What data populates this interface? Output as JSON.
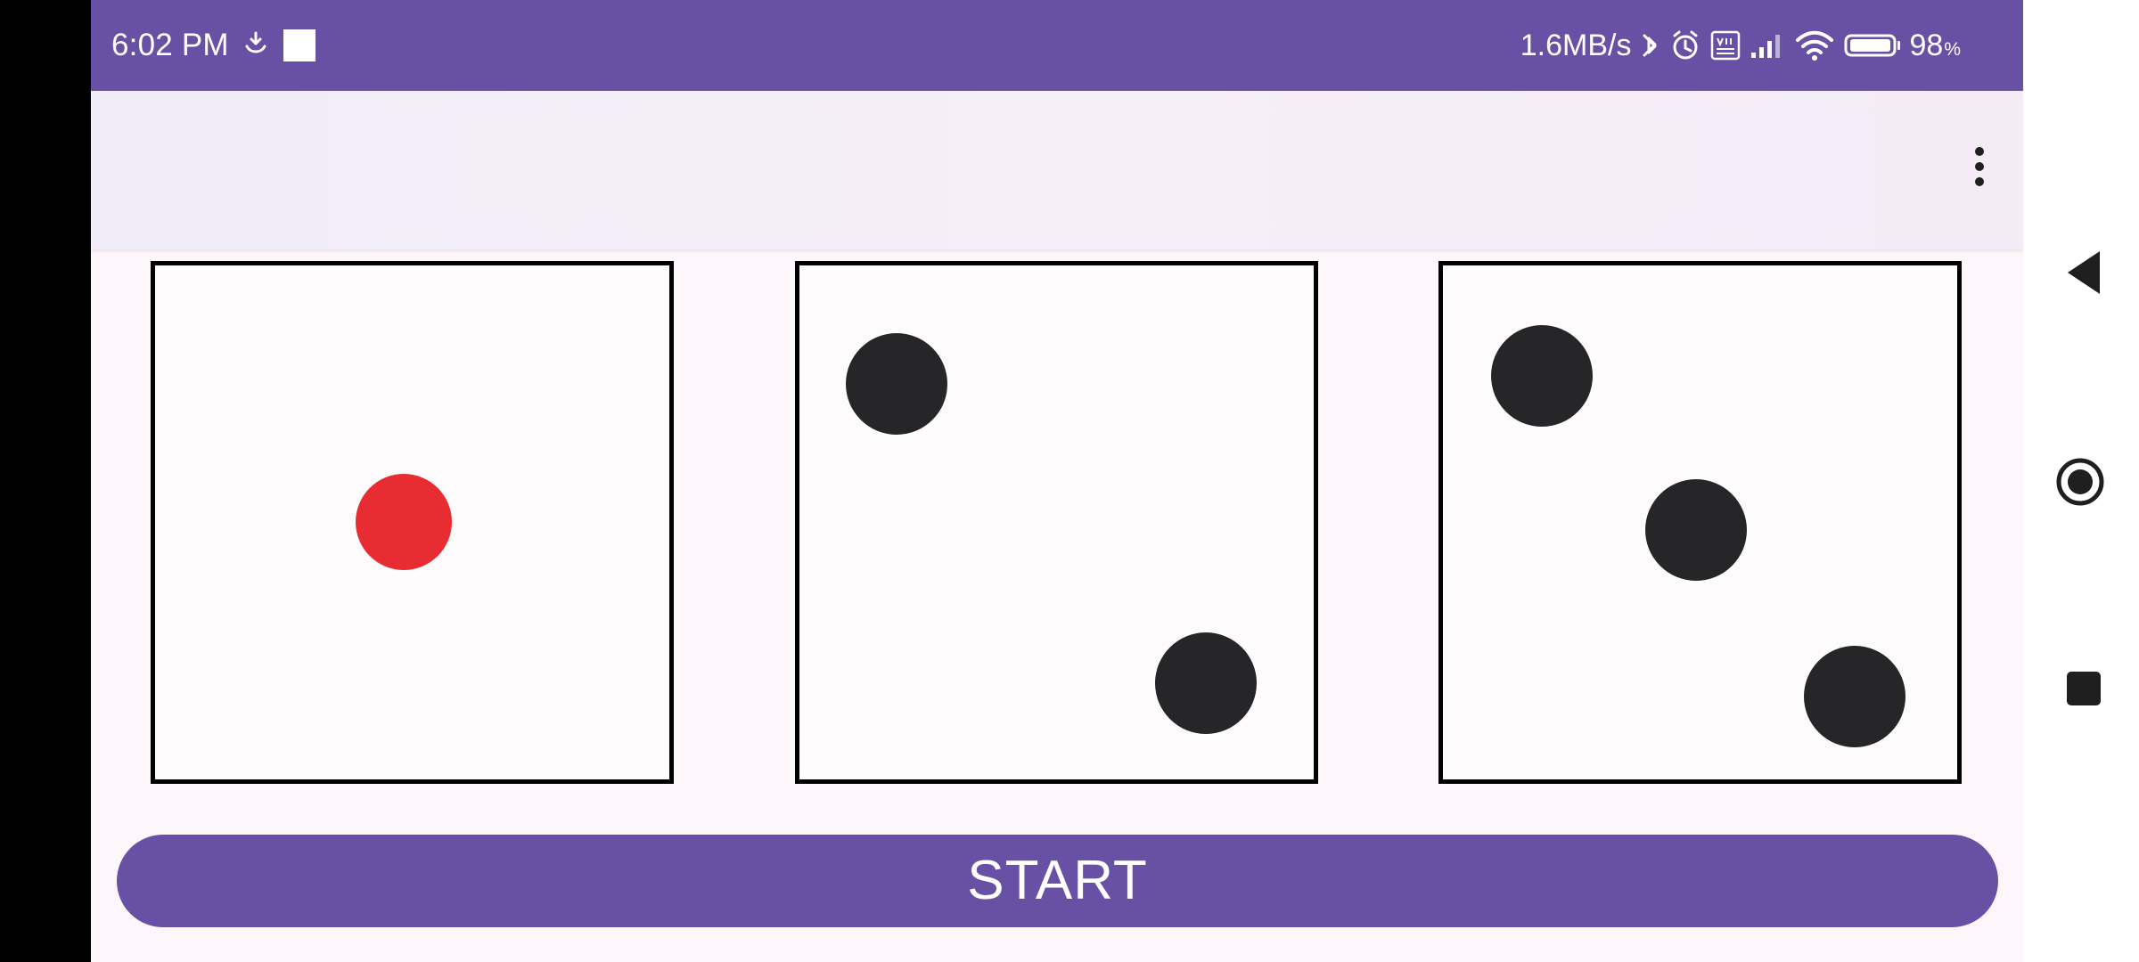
{
  "status_bar": {
    "time": "6:02 PM",
    "network_speed": "1.6MB/s",
    "battery": "98",
    "battery_unit": "%",
    "icons": [
      "download-smile-icon",
      "notification-square-icon",
      "bluetooth-icon",
      "alarm-icon",
      "volte-icon",
      "signal-icon",
      "wifi-icon",
      "battery-icon"
    ]
  },
  "toolbar": {
    "overflow_icon": "more-vertical-icon"
  },
  "dice": [
    {
      "value": 1,
      "pips": [
        {
          "position": "center",
          "color": "#e72d31"
        }
      ]
    },
    {
      "value": 2,
      "pips": [
        {
          "position": "top-left",
          "color": "#262528"
        },
        {
          "position": "bottom-right",
          "color": "#262528"
        }
      ]
    },
    {
      "value": 3,
      "pips": [
        {
          "position": "top-left",
          "color": "#262528"
        },
        {
          "position": "center",
          "color": "#262528"
        },
        {
          "position": "bottom-right",
          "color": "#262528"
        }
      ]
    }
  ],
  "actions": {
    "start_label": "START"
  },
  "navigation": {
    "back_icon": "back-triangle-icon",
    "home_icon": "home-circle-icon",
    "recents_icon": "recents-square-icon"
  },
  "colors": {
    "primary": "#6850a4",
    "app_background": "#fdf7fb",
    "red_pip": "#e72d31",
    "black_pip": "#262528",
    "dice_border": "#000000"
  }
}
